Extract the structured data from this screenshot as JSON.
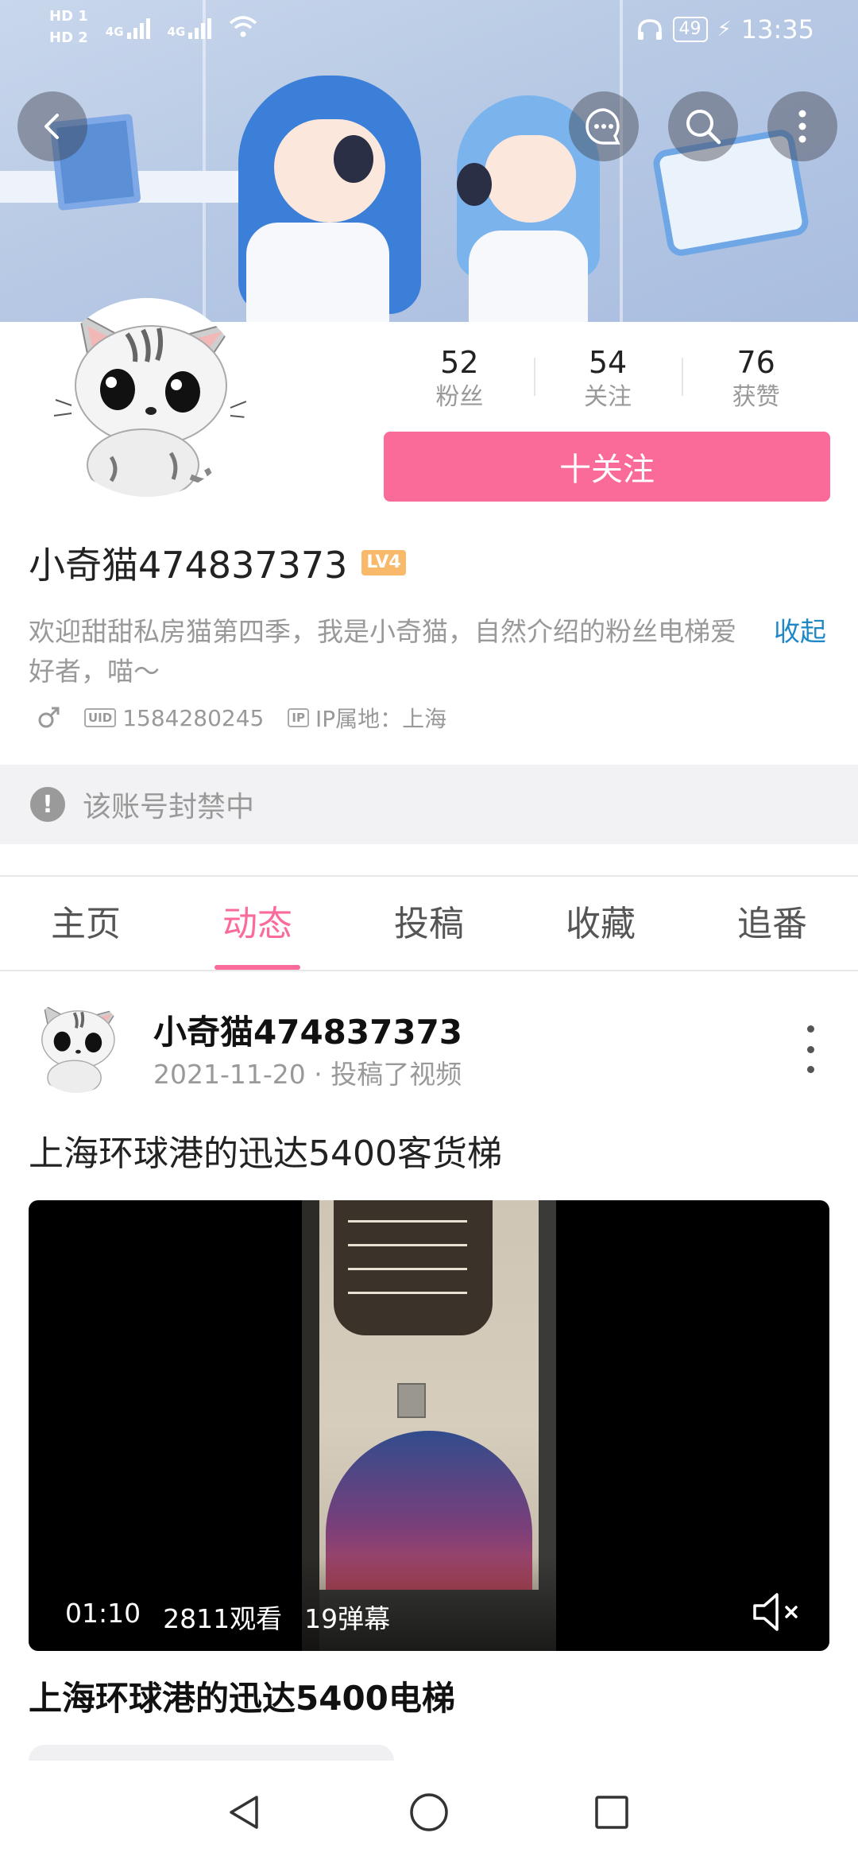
{
  "status_bar": {
    "sim1": "HD 1",
    "sim2": "HD 2",
    "net1": "4G",
    "net2": "4G",
    "battery": "49",
    "time": "13:35"
  },
  "banner_buttons": {
    "back": "back-icon",
    "message": "chat-bubble-icon",
    "search": "search-icon",
    "more": "more-vertical-icon"
  },
  "profile": {
    "stats": [
      {
        "value": "52",
        "label": "粉丝"
      },
      {
        "value": "54",
        "label": "关注"
      },
      {
        "value": "76",
        "label": "获赞"
      }
    ],
    "follow_label": "十关注",
    "follow_color": "#fb6b9a",
    "username": "小奇猫474837373",
    "level": "LV4",
    "bio": "欢迎甜甜私房猫第四季，我是小奇猫，自然介绍的粉丝电梯爱好者，喵～",
    "collapse_label": "收起",
    "uid_tag": "UID",
    "uid": "1584280245",
    "ip_tag": "IP",
    "ip_location": "IP属地：上海",
    "ban_notice": "该账号封禁中"
  },
  "tabs": [
    {
      "label": "主页",
      "active": false
    },
    {
      "label": "动态",
      "active": true
    },
    {
      "label": "投稿",
      "active": false
    },
    {
      "label": "收藏",
      "active": false
    },
    {
      "label": "追番",
      "active": false
    }
  ],
  "post": {
    "author": "小奇猫474837373",
    "date_action": "2021-11-20 · 投稿了视频",
    "title": "上海环球港的迅达5400客货梯",
    "video": {
      "duration": "01:10",
      "views": "2811观看",
      "danmaku": "19弹幕"
    },
    "video_title": "上海环球港的迅达5400电梯"
  },
  "accent_color": "#fb6b9a"
}
